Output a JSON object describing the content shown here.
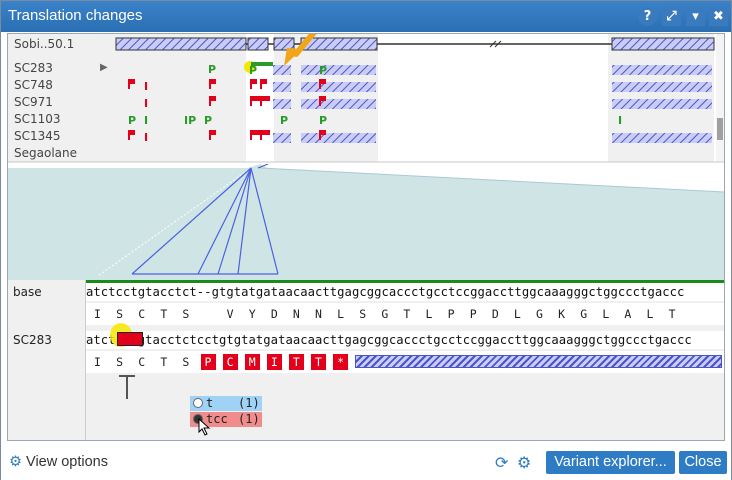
{
  "window": {
    "title": "Translation changes",
    "buttons": {
      "help": "?",
      "maximize": "⤢",
      "menu": "▾",
      "close": "✖"
    }
  },
  "overview": {
    "reference_label": "Sobi..50.1",
    "samples": [
      "SC283",
      "SC748",
      "SC971",
      "SC1103",
      "SC1345",
      "Segaolane"
    ],
    "variant_marks": [
      [
        "P",
        "P",
        "P"
      ],
      [
        "I",
        "I"
      ],
      [
        "I"
      ],
      [
        "P",
        "I",
        "IP",
        "P",
        "P",
        "P",
        "I"
      ],
      [
        "P",
        "I"
      ],
      []
    ]
  },
  "sequence": {
    "rows": [
      {
        "name": "base",
        "dna": "atctcctgtacctct--gtgtatgataacaacttgagcggcaccctgcctccggaccttggcaaagggctggccctgaccc",
        "aa": [
          "I",
          "S",
          "C",
          "T",
          "S",
          "",
          "V",
          "Y",
          "D",
          "N",
          "N",
          "L",
          "S",
          "G",
          "T",
          "L",
          "P",
          "P",
          "D",
          "L",
          "G",
          "K",
          "G",
          "L",
          "A",
          "L",
          "T"
        ]
      },
      {
        "name": "SC283",
        "dna": "atctcctgtacctctcctgtgtatgataacaacttgagcggcaccctgcctccggaccttggcaaagggctggccctgaccc",
        "aa": [
          "I",
          "S",
          "C",
          "T",
          "S",
          "P",
          "C",
          "M",
          "I",
          "T",
          "T",
          "*"
        ],
        "aa_changed": [
          false,
          false,
          false,
          false,
          false,
          true,
          true,
          true,
          true,
          true,
          true,
          true
        ]
      }
    ]
  },
  "variant_popup": {
    "options": [
      {
        "allele": "t",
        "count": "(1)",
        "color": "#9fd2f5"
      },
      {
        "allele": "tcc",
        "count": "(1)",
        "color": "#f08c8c"
      }
    ]
  },
  "footer": {
    "view_options": "View options",
    "variant_explorer": "Variant explorer...",
    "close": "Close"
  },
  "colors": {
    "titlebar": "#2e75bb",
    "accent": "#2e7cc4",
    "variant_red": "#e3001b",
    "variant_green": "#2a9a2a",
    "feature_blue": "#4a54c8",
    "highlight_yellow": "#f5e800",
    "arrow_orange": "#f2a51a"
  }
}
